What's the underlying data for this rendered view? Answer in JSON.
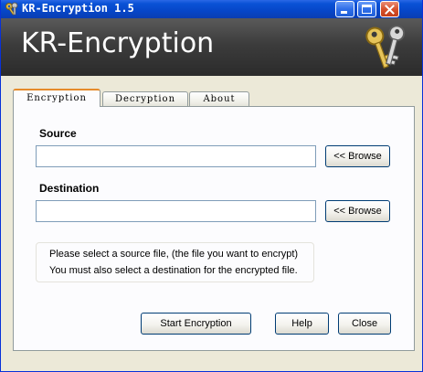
{
  "window": {
    "title": "KR-Encryption 1.5",
    "icon": "keys-icon",
    "controls": [
      "minimize-icon",
      "maximize-icon",
      "close-icon"
    ]
  },
  "banner": {
    "title": "KR-Encryption",
    "icon": "keys-icon"
  },
  "tabs": [
    {
      "label": "Encryption",
      "active": true
    },
    {
      "label": "Decryption",
      "active": false
    },
    {
      "label": "About",
      "active": false
    }
  ],
  "encryption_tab": {
    "source_label": "Source",
    "source_value": "",
    "browse_source_label": "<< Browse",
    "destination_label": "Destination",
    "destination_value": "",
    "browse_destination_label": "<< Browse",
    "info_line1": "Please select a source file, (the file you want to encrypt)",
    "info_line2": "You must also select a destination for the encrypted file.",
    "start_label": "Start Encryption",
    "help_label": "Help",
    "close_label": "Close"
  },
  "colors": {
    "titlebar": "#0a52d6",
    "banner": "#3c3c3c",
    "window_bg": "#ece9d8",
    "active_tab_accent": "#e68b2c"
  }
}
